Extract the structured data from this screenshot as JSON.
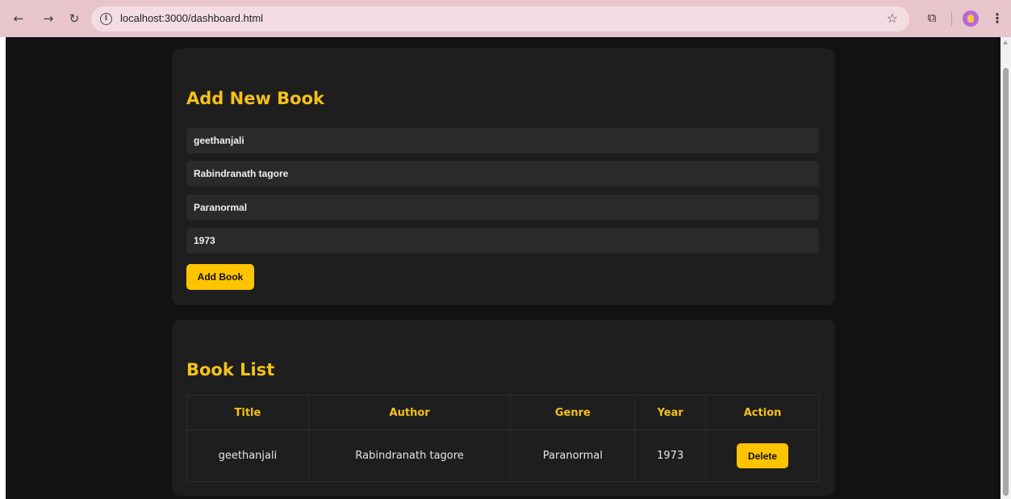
{
  "browser": {
    "url": "localhost:3000/dashboard.html",
    "icons": [
      "back-arrow-icon",
      "forward-arrow-icon",
      "reload-icon",
      "info-icon",
      "star-icon",
      "extensions-icon",
      "profile-avatar-icon",
      "menu-icon"
    ]
  },
  "form": {
    "title": "Add New Book",
    "fields": {
      "title": "geethanjali",
      "author": "Rabindranath tagore",
      "genre": "Paranormal",
      "year": "1973"
    },
    "submit_label": "Add Book"
  },
  "list": {
    "title": "Book List",
    "headers": [
      "Title",
      "Author",
      "Genre",
      "Year",
      "Action"
    ],
    "rows": [
      {
        "title": "geethanjali",
        "author": "Rabindranath tagore",
        "genre": "Paranormal",
        "year": "1973",
        "action_label": "Delete"
      }
    ]
  },
  "colors": {
    "accent": "#ffc400",
    "heading": "#f5c11a",
    "background": "#121212",
    "card": "#1e1e1e",
    "chrome": "#e8c4cb"
  }
}
